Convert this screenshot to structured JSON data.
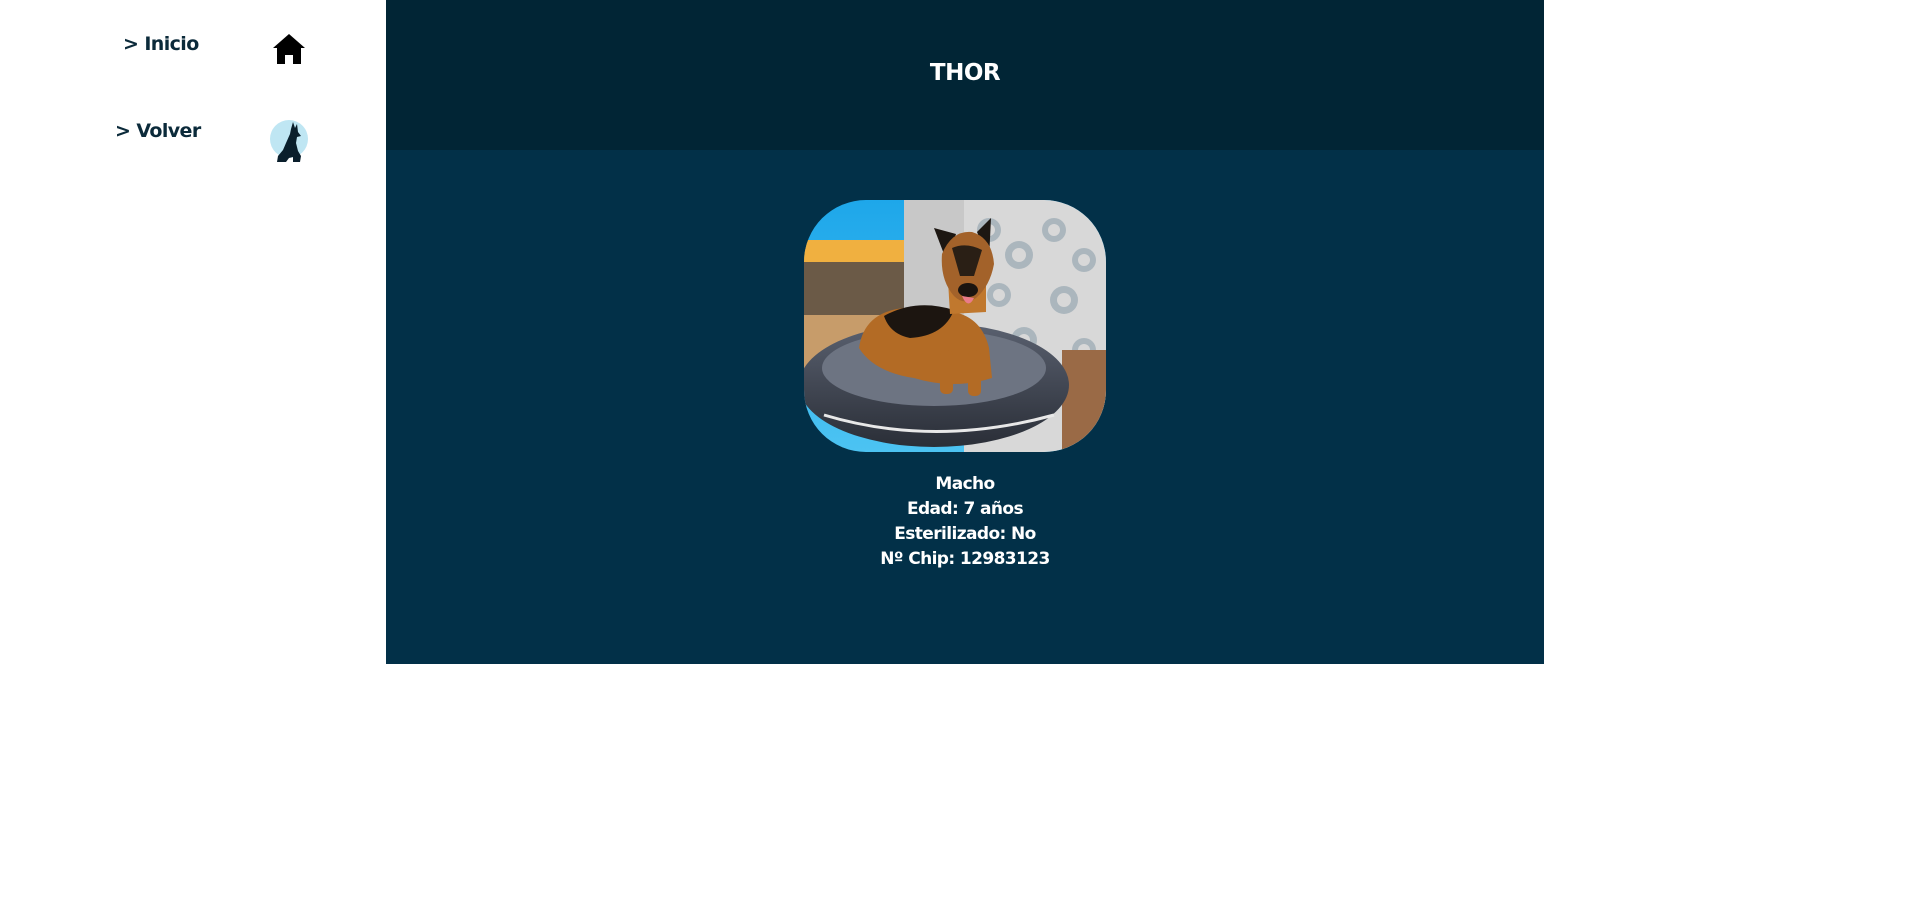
{
  "nav": {
    "items": [
      {
        "label": "> Inicio",
        "icon": "home-icon"
      },
      {
        "label": "> Volver",
        "icon": "dog-silhouette-icon"
      }
    ]
  },
  "pet": {
    "name": "THOR",
    "sex": "Macho",
    "age": "Edad: 7 años",
    "sterilized": "Esterilizado: No",
    "chip": "Nº Chip: 12983123",
    "photo_alt": "German shepherd lying on a dog bed"
  },
  "colors": {
    "header_bg": "#012535",
    "body_bg": "#023048",
    "nav_text": "#0b2a3a",
    "text_light": "#ffffff"
  }
}
